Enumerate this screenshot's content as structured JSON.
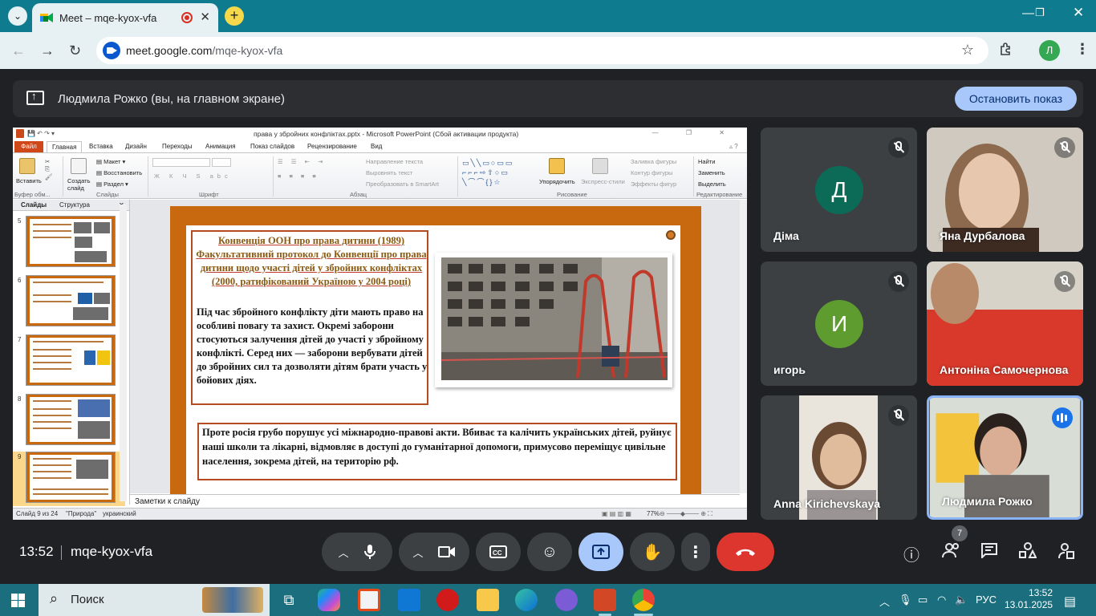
{
  "browser": {
    "tab_title": "Meet – mqe-kyox-vfa",
    "url_host": "meet.google.com",
    "url_path": "/mqe-kyox-vfa",
    "profile_initial": "Л"
  },
  "meet": {
    "presenting_banner": "Людмила Рожко (вы, на главном экране)",
    "stop_sharing_label": "Остановить показ",
    "clock": "13:52",
    "meeting_code": "mqe-kyox-vfa",
    "participant_count": "7",
    "participants": [
      {
        "name": "Діма",
        "initial": "Д",
        "avatar_color": "#0b6b57",
        "muted": true,
        "video": false
      },
      {
        "name": "Яна Дурбалова",
        "muted": true,
        "video": true
      },
      {
        "name": "игорь",
        "initial": "И",
        "avatar_color": "#5e9c2f",
        "muted": true,
        "video": false
      },
      {
        "name": "Антоніна Самочернова",
        "muted": true,
        "video": true
      },
      {
        "name": "Anna Kirichevskaya",
        "muted": true,
        "video": true
      },
      {
        "name": "Людмила Рожко",
        "muted": false,
        "video": true,
        "speaking": true
      }
    ]
  },
  "ppt": {
    "window_title": "права у збройних конфліктах.pptx - Microsoft PowerPoint (Сбой активации продукта)",
    "file_tab": "Файл",
    "ribbon_tabs": [
      "Главная",
      "Вставка",
      "Дизайн",
      "Переходы",
      "Анимация",
      "Показ слайдов",
      "Рецензирование",
      "Вид"
    ],
    "groups": {
      "clipboard": "Буфер обм...",
      "slides": "Слайды",
      "font": "Шрифт",
      "paragraph": "Абзац",
      "drawing": "Рисование",
      "editing": "Редактирование"
    },
    "buttons": {
      "paste": "Вставить",
      "new_slide": "Создать слайд",
      "layout": "Макет",
      "reset": "Восстановить",
      "section": "Раздел",
      "text_direction": "Направление текста",
      "align_text": "Выровнять текст",
      "smartart": "Преобразовать в SmartArt",
      "arrange": "Упорядочить",
      "quick_styles": "Экспресс-стили",
      "shape_fill": "Заливка фигуры",
      "shape_outline": "Контур фигуры",
      "shape_effects": "Эффекты фигур",
      "find": "Найти",
      "replace": "Заменить",
      "select": "Выделить"
    },
    "panel_tabs": {
      "slides": "Слайды",
      "outline": "Структура"
    },
    "thumbnails": [
      "5",
      "6",
      "7",
      "8",
      "9"
    ],
    "selected_slide": "9",
    "slide": {
      "title_plain_1": "Конвенція ООН про права дитини (1989)",
      "title_plain_2": "Факультативний протокол до Конвенції про права дитини щодо участі дітей у збройних конфліктах (2000, ратифікований Україною у 2004 році)",
      "body": "Під час збройного конфлікту діти мають право на особливі повагу та захист. Окремі заборони стосуються залучення дітей до участі у збройному конфлікті. Серед них — заборони вербувати дітей до збройних сил та дозволяти дітям брати участь у бойових діях.",
      "bottom": "Проте  росія грубо порушує усі міжнародно-правові акти. Вбиває та калічить  українських дітей, руйнує наші школи та лікарні, відмовляє в доступі до гуманітарної допомоги, примусово переміщує цивільне населення, зокрема дітей, на територію рф."
    },
    "notes_placeholder": "Заметки к слайду",
    "status": {
      "slide_info": "Слайд 9 из 24",
      "theme": "\"Природа\"",
      "language": "украинский",
      "zoom": "77%"
    }
  },
  "taskbar": {
    "search_label": "Поиск",
    "language": "РУС",
    "time": "13:52",
    "date": "13.01.2025"
  }
}
